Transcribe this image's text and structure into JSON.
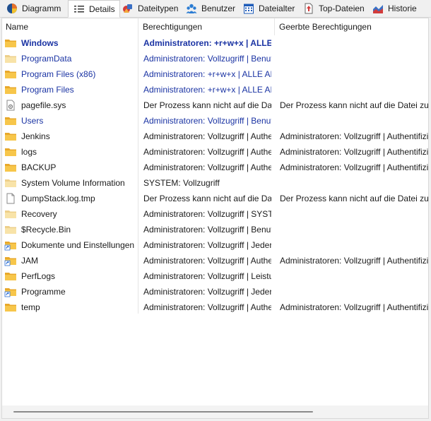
{
  "tabs": [
    {
      "label": "Diagramm",
      "icon": "pie-chart-icon"
    },
    {
      "label": "Details",
      "icon": "details-list-icon"
    },
    {
      "label": "Dateitypen",
      "icon": "file-types-icon"
    },
    {
      "label": "Benutzer",
      "icon": "users-icon"
    },
    {
      "label": "Dateialter",
      "icon": "calendar-icon"
    },
    {
      "label": "Top-Dateien",
      "icon": "top-files-icon"
    },
    {
      "label": "Historie",
      "icon": "history-chart-icon"
    }
  ],
  "active_tab": "Details",
  "columns": {
    "name": "Name",
    "permissions": "Berechtigungen",
    "inherited": "Geerbte Berechtigungen"
  },
  "rows": [
    {
      "name": "Windows",
      "icon": "folder-icon",
      "permissions": "Administratoren: +r+w+x | ALLE ANWENDUNGSPAKETE",
      "inherited": "",
      "style": "blue-bold"
    },
    {
      "name": "ProgramData",
      "icon": "folder-light-icon",
      "permissions": "Administratoren: Vollzugriff | Benutzer",
      "inherited": "",
      "style": "blue"
    },
    {
      "name": "Program Files (x86)",
      "icon": "folder-icon",
      "permissions": "Administratoren: +r+w+x | ALLE ANWENDUNGSPAKETE",
      "inherited": "",
      "style": "blue"
    },
    {
      "name": "Program Files",
      "icon": "folder-icon",
      "permissions": "Administratoren: +r+w+x | ALLE ANWENDUNGSPAKETE",
      "inherited": "",
      "style": "blue"
    },
    {
      "name": "pagefile.sys",
      "icon": "system-file-icon",
      "permissions": "Der Prozess kann nicht auf die Datei zugreifen",
      "inherited": "Der Prozess kann nicht auf die Datei zugreifen",
      "style": "normal"
    },
    {
      "name": "Users",
      "icon": "folder-icon",
      "permissions": "Administratoren: Vollzugriff | Benutzer",
      "inherited": "",
      "style": "blue"
    },
    {
      "name": "Jenkins",
      "icon": "folder-icon",
      "permissions": "Administratoren: Vollzugriff | Authentifizierte Benutzer",
      "inherited": "Administratoren: Vollzugriff | Authentifizierte Benutzer",
      "style": "normal"
    },
    {
      "name": "logs",
      "icon": "folder-icon",
      "permissions": "Administratoren: Vollzugriff | Authentifizierte Benutzer",
      "inherited": "Administratoren: Vollzugriff | Authentifizierte Benutzer",
      "style": "normal"
    },
    {
      "name": "BACKUP",
      "icon": "folder-icon",
      "permissions": "Administratoren: Vollzugriff | Authentifizierte Benutzer",
      "inherited": "Administratoren: Vollzugriff | Authentifizierte Benutzer",
      "style": "normal"
    },
    {
      "name": "System Volume Information",
      "icon": "folder-light-icon",
      "permissions": "SYSTEM: Vollzugriff",
      "inherited": "",
      "style": "normal"
    },
    {
      "name": "DumpStack.log.tmp",
      "icon": "file-icon",
      "permissions": "Der Prozess kann nicht auf die Datei zugreifen",
      "inherited": "Der Prozess kann nicht auf die Datei zugreifen",
      "style": "normal"
    },
    {
      "name": "Recovery",
      "icon": "folder-light-icon",
      "permissions": "Administratoren: Vollzugriff | SYSTEM",
      "inherited": "",
      "style": "normal"
    },
    {
      "name": "$Recycle.Bin",
      "icon": "folder-light-icon",
      "permissions": "Administratoren: Vollzugriff | Benutzer",
      "inherited": "",
      "style": "normal"
    },
    {
      "name": "Dokumente und Einstellungen",
      "icon": "folder-shortcut-icon",
      "permissions": "Administratoren: Vollzugriff | Jeder",
      "inherited": "",
      "style": "normal"
    },
    {
      "name": "JAM",
      "icon": "folder-shortcut-icon",
      "permissions": "Administratoren: Vollzugriff | Authentifizierte Benutzer",
      "inherited": "Administratoren: Vollzugriff | Authentifizierte Benutzer",
      "style": "normal"
    },
    {
      "name": "PerfLogs",
      "icon": "folder-icon",
      "permissions": "Administratoren: Vollzugriff | Leistungsprotokollbenutzer",
      "inherited": "",
      "style": "normal"
    },
    {
      "name": "Programme",
      "icon": "folder-shortcut-icon",
      "permissions": "Administratoren: Vollzugriff | Jeder",
      "inherited": "",
      "style": "normal"
    },
    {
      "name": "temp",
      "icon": "folder-icon",
      "permissions": "Administratoren: Vollzugriff | Authentifizierte Benutzer",
      "inherited": "Administratoren: Vollzugriff | Authentifizierte Benutzer",
      "style": "normal"
    }
  ]
}
